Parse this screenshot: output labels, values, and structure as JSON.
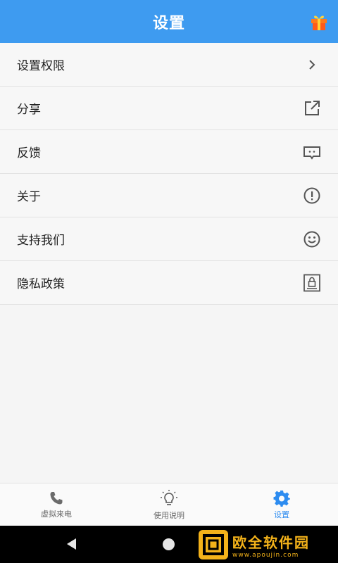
{
  "header": {
    "title": "设置",
    "gift_icon": "gift-icon"
  },
  "rows": [
    {
      "label": "设置权限",
      "icon": "chevron-right-icon"
    },
    {
      "label": "分享",
      "icon": "share-external-icon"
    },
    {
      "label": "反馈",
      "icon": "feedback-message-icon"
    },
    {
      "label": "关于",
      "icon": "info-circle-icon"
    },
    {
      "label": "支持我们",
      "icon": "smile-icon"
    },
    {
      "label": "隐私政策",
      "icon": "privacy-lock-icon"
    }
  ],
  "tabs": [
    {
      "label": "虚拟来电",
      "icon": "phone-icon",
      "active": false
    },
    {
      "label": "使用说明",
      "icon": "lightbulb-icon",
      "active": false
    },
    {
      "label": "设置",
      "icon": "gear-icon",
      "active": true
    }
  ],
  "watermark": {
    "title": "欧全软件园",
    "url": "www.apoujin.com"
  },
  "colors": {
    "accent": "#3e9bf0",
    "active_tab": "#2d8cf0",
    "watermark": "#f3b21a"
  }
}
